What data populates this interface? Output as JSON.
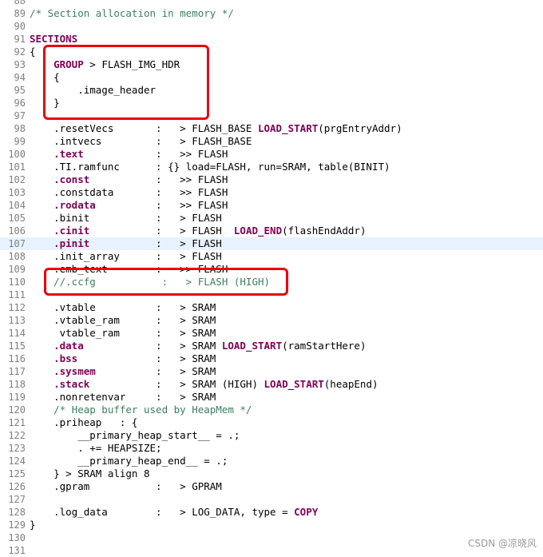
{
  "editor": {
    "highlighted_line": 107,
    "lines": [
      {
        "num": "88",
        "tokens": []
      },
      {
        "num": "89",
        "tokens": [
          {
            "t": "/* Section allocation in memory */",
            "c": "cm"
          }
        ]
      },
      {
        "num": "90",
        "tokens": []
      },
      {
        "num": "91",
        "tokens": [
          {
            "t": "SECTIONS",
            "c": "kw"
          }
        ]
      },
      {
        "num": "92",
        "tokens": [
          {
            "t": "{"
          }
        ]
      },
      {
        "num": "93",
        "tokens": [
          {
            "t": "    "
          },
          {
            "t": "GROUP",
            "c": "kw"
          },
          {
            "t": " > FLASH_IMG_HDR"
          }
        ]
      },
      {
        "num": "94",
        "tokens": [
          {
            "t": "    {"
          }
        ]
      },
      {
        "num": "95",
        "tokens": [
          {
            "t": "        .image_header"
          }
        ]
      },
      {
        "num": "96",
        "tokens": [
          {
            "t": "    }"
          }
        ]
      },
      {
        "num": "97",
        "tokens": []
      },
      {
        "num": "98",
        "tokens": [
          {
            "t": "    .resetVecs       :   > FLASH_BASE "
          },
          {
            "t": "LOAD_START",
            "c": "kw"
          },
          {
            "t": "(prgEntryAddr)"
          }
        ]
      },
      {
        "num": "99",
        "tokens": [
          {
            "t": "    .intvecs         :   > FLASH_BASE"
          }
        ]
      },
      {
        "num": "100",
        "tokens": [
          {
            "t": "    "
          },
          {
            "t": ".text",
            "c": "kw"
          },
          {
            "t": "            :   >> FLASH"
          }
        ]
      },
      {
        "num": "101",
        "tokens": [
          {
            "t": "    .TI.ramfunc      : {} load=FLASH, run=SRAM, table(BINIT)"
          }
        ]
      },
      {
        "num": "102",
        "tokens": [
          {
            "t": "    "
          },
          {
            "t": ".const",
            "c": "kw"
          },
          {
            "t": "           :   >> FLASH"
          }
        ]
      },
      {
        "num": "103",
        "tokens": [
          {
            "t": "    .constdata       :   >> FLASH"
          }
        ]
      },
      {
        "num": "104",
        "tokens": [
          {
            "t": "    "
          },
          {
            "t": ".rodata",
            "c": "kw"
          },
          {
            "t": "          :   >> FLASH"
          }
        ]
      },
      {
        "num": "105",
        "tokens": [
          {
            "t": "    .binit           :   > FLASH"
          }
        ]
      },
      {
        "num": "106",
        "tokens": [
          {
            "t": "    "
          },
          {
            "t": ".cinit",
            "c": "kw"
          },
          {
            "t": "           :   > FLASH  "
          },
          {
            "t": "LOAD_END",
            "c": "kw"
          },
          {
            "t": "(flashEndAddr)"
          }
        ]
      },
      {
        "num": "107",
        "tokens": [
          {
            "t": "    "
          },
          {
            "t": ".pinit",
            "c": "kw"
          },
          {
            "t": "           :   > FLASH"
          }
        ]
      },
      {
        "num": "108",
        "tokens": [
          {
            "t": "    .init_array      :   > FLASH"
          }
        ]
      },
      {
        "num": "109",
        "tokens": [
          {
            "t": "    .emb_text        :   >> FLASH"
          }
        ]
      },
      {
        "num": "110",
        "tokens": [
          {
            "t": "    //.ccfg           :   > FLASH (HIGH)",
            "c": "cm"
          }
        ]
      },
      {
        "num": "111",
        "tokens": []
      },
      {
        "num": "112",
        "tokens": [
          {
            "t": "    .vtable          :   > SRAM"
          }
        ]
      },
      {
        "num": "113",
        "tokens": [
          {
            "t": "    .vtable_ram      :   > SRAM"
          }
        ]
      },
      {
        "num": "114",
        "tokens": [
          {
            "t": "     vtable_ram      :   > SRAM"
          }
        ]
      },
      {
        "num": "115",
        "tokens": [
          {
            "t": "    "
          },
          {
            "t": ".data",
            "c": "kw"
          },
          {
            "t": "            :   > SRAM "
          },
          {
            "t": "LOAD_START",
            "c": "kw"
          },
          {
            "t": "(ramStartHere)"
          }
        ]
      },
      {
        "num": "116",
        "tokens": [
          {
            "t": "    "
          },
          {
            "t": ".bss",
            "c": "kw"
          },
          {
            "t": "             :   > SRAM"
          }
        ]
      },
      {
        "num": "117",
        "tokens": [
          {
            "t": "    "
          },
          {
            "t": ".sysmem",
            "c": "kw"
          },
          {
            "t": "          :   > SRAM"
          }
        ]
      },
      {
        "num": "118",
        "tokens": [
          {
            "t": "    "
          },
          {
            "t": ".stack",
            "c": "kw"
          },
          {
            "t": "           :   > SRAM (HIGH) "
          },
          {
            "t": "LOAD_START",
            "c": "kw"
          },
          {
            "t": "(heapEnd)"
          }
        ]
      },
      {
        "num": "119",
        "tokens": [
          {
            "t": "    .nonretenvar     :   > SRAM"
          }
        ]
      },
      {
        "num": "120",
        "tokens": [
          {
            "t": "    /* Heap buffer used by HeapMem */",
            "c": "cm"
          }
        ]
      },
      {
        "num": "121",
        "tokens": [
          {
            "t": "    .priheap   : {"
          }
        ]
      },
      {
        "num": "122",
        "tokens": [
          {
            "t": "        __primary_heap_start__ = .;"
          }
        ]
      },
      {
        "num": "123",
        "tokens": [
          {
            "t": "        . += HEAPSIZE;"
          }
        ]
      },
      {
        "num": "124",
        "tokens": [
          {
            "t": "        __primary_heap_end__ = .;"
          }
        ]
      },
      {
        "num": "125",
        "tokens": [
          {
            "t": "    } > SRAM align 8"
          }
        ]
      },
      {
        "num": "126",
        "tokens": [
          {
            "t": "    .gpram           :   > GPRAM"
          }
        ]
      },
      {
        "num": "127",
        "tokens": []
      },
      {
        "num": "128",
        "tokens": [
          {
            "t": "    .log_data        :   > LOG_DATA, type = "
          },
          {
            "t": "COPY",
            "c": "kw"
          }
        ]
      },
      {
        "num": "129",
        "tokens": [
          {
            "t": "}"
          }
        ]
      },
      {
        "num": "130",
        "tokens": []
      },
      {
        "num": "131",
        "tokens": []
      }
    ]
  },
  "watermark": "CSDN @凉晓风",
  "colors": {
    "keyword": "#7f0055",
    "comment": "#3f7f5f",
    "annotation_box": "#e60012",
    "highlight_line": "#e8f2fe"
  }
}
